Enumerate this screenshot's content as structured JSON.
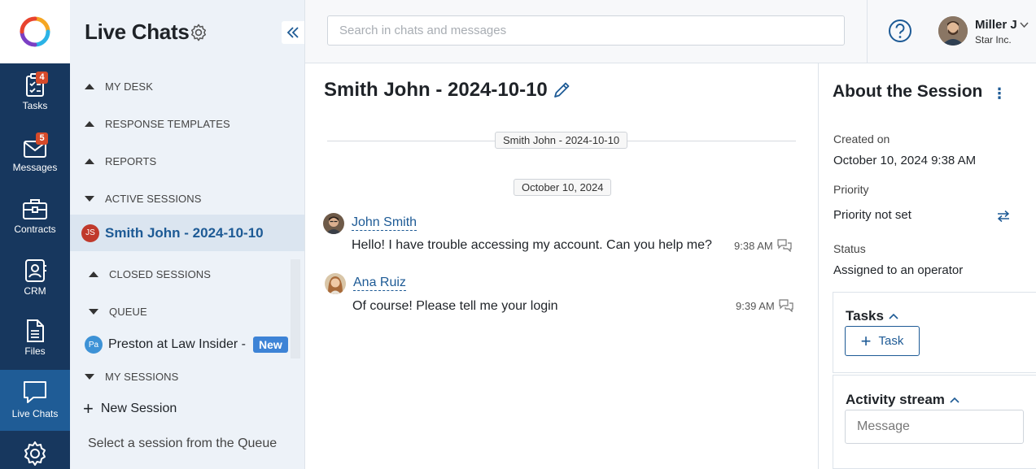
{
  "rail": {
    "items": [
      {
        "label": "Tasks",
        "icon": "clipboard-check-icon",
        "badge": "4"
      },
      {
        "label": "Messages",
        "icon": "envelope-icon",
        "badge": "5"
      },
      {
        "label": "Contracts",
        "icon": "briefcase-icon"
      },
      {
        "label": "CRM",
        "icon": "contact-card-icon"
      },
      {
        "label": "Files",
        "icon": "document-icon"
      },
      {
        "label": "Live Chats",
        "icon": "chat-bubble-icon",
        "active": true
      },
      {
        "label": "",
        "icon": "gear-icon"
      }
    ]
  },
  "panel": {
    "title": "Live Chats",
    "groups": {
      "my_desk": "MY DESK",
      "response_templates": "RESPONSE TEMPLATES",
      "reports": "REPORTS",
      "active_sessions": "ACTIVE SESSIONS",
      "closed_sessions": "CLOSED SESSIONS",
      "queue": "QUEUE",
      "my_sessions": "MY SESSIONS"
    },
    "active_session": {
      "initials": "JS",
      "label": "Smith John - 2024-10-10"
    },
    "queue_item": {
      "initials": "Pa",
      "label": "Preston at Law Insider -",
      "badge": "New"
    },
    "new_session": "New Session",
    "hint": "Select a session from the Queue"
  },
  "topbar": {
    "search_placeholder": "Search in chats and messages",
    "user_name": "Miller J",
    "user_company": "Star Inc."
  },
  "chat": {
    "title": "Smith John - 2024-10-10",
    "session_chip": "Smith John - 2024-10-10",
    "date_chip": "October 10, 2024",
    "messages": [
      {
        "author": "John Smith",
        "text": "Hello! I have trouble accessing my account. Can you help me?",
        "time": "9:38 AM"
      },
      {
        "author": "Ana Ruiz",
        "text": "Of course! Please tell me your login",
        "time": "9:39 AM"
      }
    ]
  },
  "about": {
    "title": "About the Session",
    "created_label": "Created on",
    "created_value": "October 10, 2024 9:38 AM",
    "priority_label": "Priority",
    "priority_value": "Priority not set",
    "status_label": "Status",
    "status_value": "Assigned to an operator",
    "tasks_title": "Tasks",
    "task_button": "Task",
    "activity_title": "Activity stream",
    "message_placeholder": "Message"
  },
  "colors": {
    "rail_bg": "#17375e",
    "rail_active": "#1f5c96",
    "accent": "#1d5a95",
    "badge": "#d64a2a",
    "new_badge": "#3d83d6"
  }
}
